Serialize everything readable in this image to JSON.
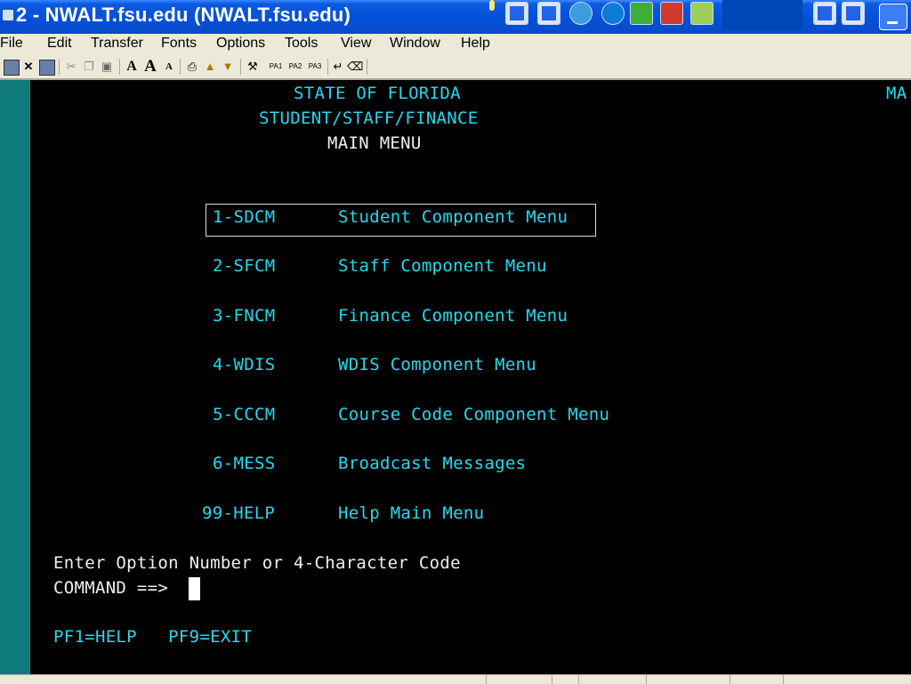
{
  "window": {
    "title": "2 - NWALT.fsu.edu (NWALT.fsu.edu)"
  },
  "menu": [
    "File",
    "Edit",
    "Transfer",
    "Fonts",
    "Options",
    "Tools",
    "View",
    "Window",
    "Help"
  ],
  "toolbar": {
    "font_large": "A",
    "font_grow": "A",
    "font_shrink": "A",
    "pf1": "PA1",
    "pf2": "PA2",
    "pf3": "PA3",
    "enter": "↵"
  },
  "terminal": {
    "header1": "STATE OF FLORIDA",
    "header2": "STUDENT/STAFF/FINANCE",
    "header3": "MAIN MENU",
    "corner": "MA",
    "options": [
      {
        "code": "1-SDCM",
        "label": "Student Component Menu"
      },
      {
        "code": "2-SFCM",
        "label": "Staff Component Menu"
      },
      {
        "code": "3-FNCM",
        "label": "Finance Component Menu"
      },
      {
        "code": "4-WDIS",
        "label": "WDIS Component Menu"
      },
      {
        "code": "5-CCCM",
        "label": "Course Code Component Menu"
      },
      {
        "code": "6-MESS",
        "label": "Broadcast Messages"
      },
      {
        "code": "99-HELP",
        "label": "Help Main Menu"
      }
    ],
    "prompt": "Enter Option Number or 4-Character Code",
    "command_label": "COMMAND ==>",
    "pf_keys": "PF1=HELP   PF9=EXIT"
  },
  "colors": {
    "terminal_text": "#24d9ee",
    "terminal_bg": "#000000",
    "left_strip": "#0f7b7b"
  }
}
